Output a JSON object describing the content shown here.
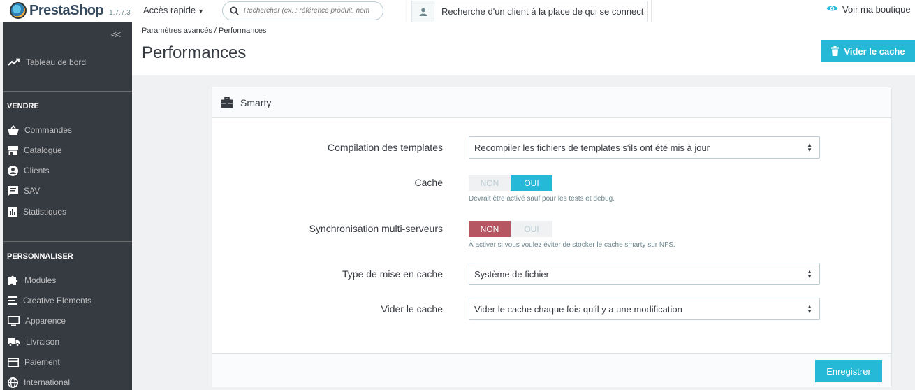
{
  "header": {
    "logo_text": "PrestaShop",
    "version": "1.7.7.3",
    "quick_access": "Accès rapide",
    "search_placeholder": "Rechercher (ex. : référence produit, nom",
    "customer_search": "Recherche d'un client à la place de qui se connecter",
    "view_shop": "Voir ma boutique"
  },
  "sidebar": {
    "dashboard": "Tableau de bord",
    "section_sell": "VENDRE",
    "sell_items": [
      "Commandes",
      "Catalogue",
      "Clients",
      "SAV",
      "Statistiques"
    ],
    "section_custom": "PERSONNALISER",
    "custom_items": [
      "Modules",
      "Creative Elements",
      "Apparence",
      "Livraison",
      "Paiement",
      "International"
    ]
  },
  "page": {
    "breadcrumb": "Paramètres avancés /  Performances",
    "title": "Performances",
    "clear_cache_button": "Vider le cache"
  },
  "card": {
    "title": "Smarty",
    "fields": {
      "compilation_label": "Compilation des templates",
      "compilation_value": "Recompiler les fichiers de templates s'ils ont été mis à jour",
      "cache_label": "Cache",
      "cache_off": "NON",
      "cache_on": "OUI",
      "cache_help": "Devrait être activé sauf pour les tests et debug.",
      "sync_label": "Synchronisation multi-serveurs",
      "sync_off": "NON",
      "sync_on": "OUI",
      "sync_help": "À activer si vous voulez éviter de stocker le cache smarty sur NFS.",
      "type_label": "Type de mise en cache",
      "type_value": "Système de fichier",
      "clear_label": "Vider le cache",
      "clear_value": "Vider le cache chaque fois qu'il y a une modification"
    },
    "save_button": "Enregistrer"
  },
  "colors": {
    "accent": "#25b9d7",
    "sidebar_bg": "#363a41",
    "danger": "#b55662"
  }
}
